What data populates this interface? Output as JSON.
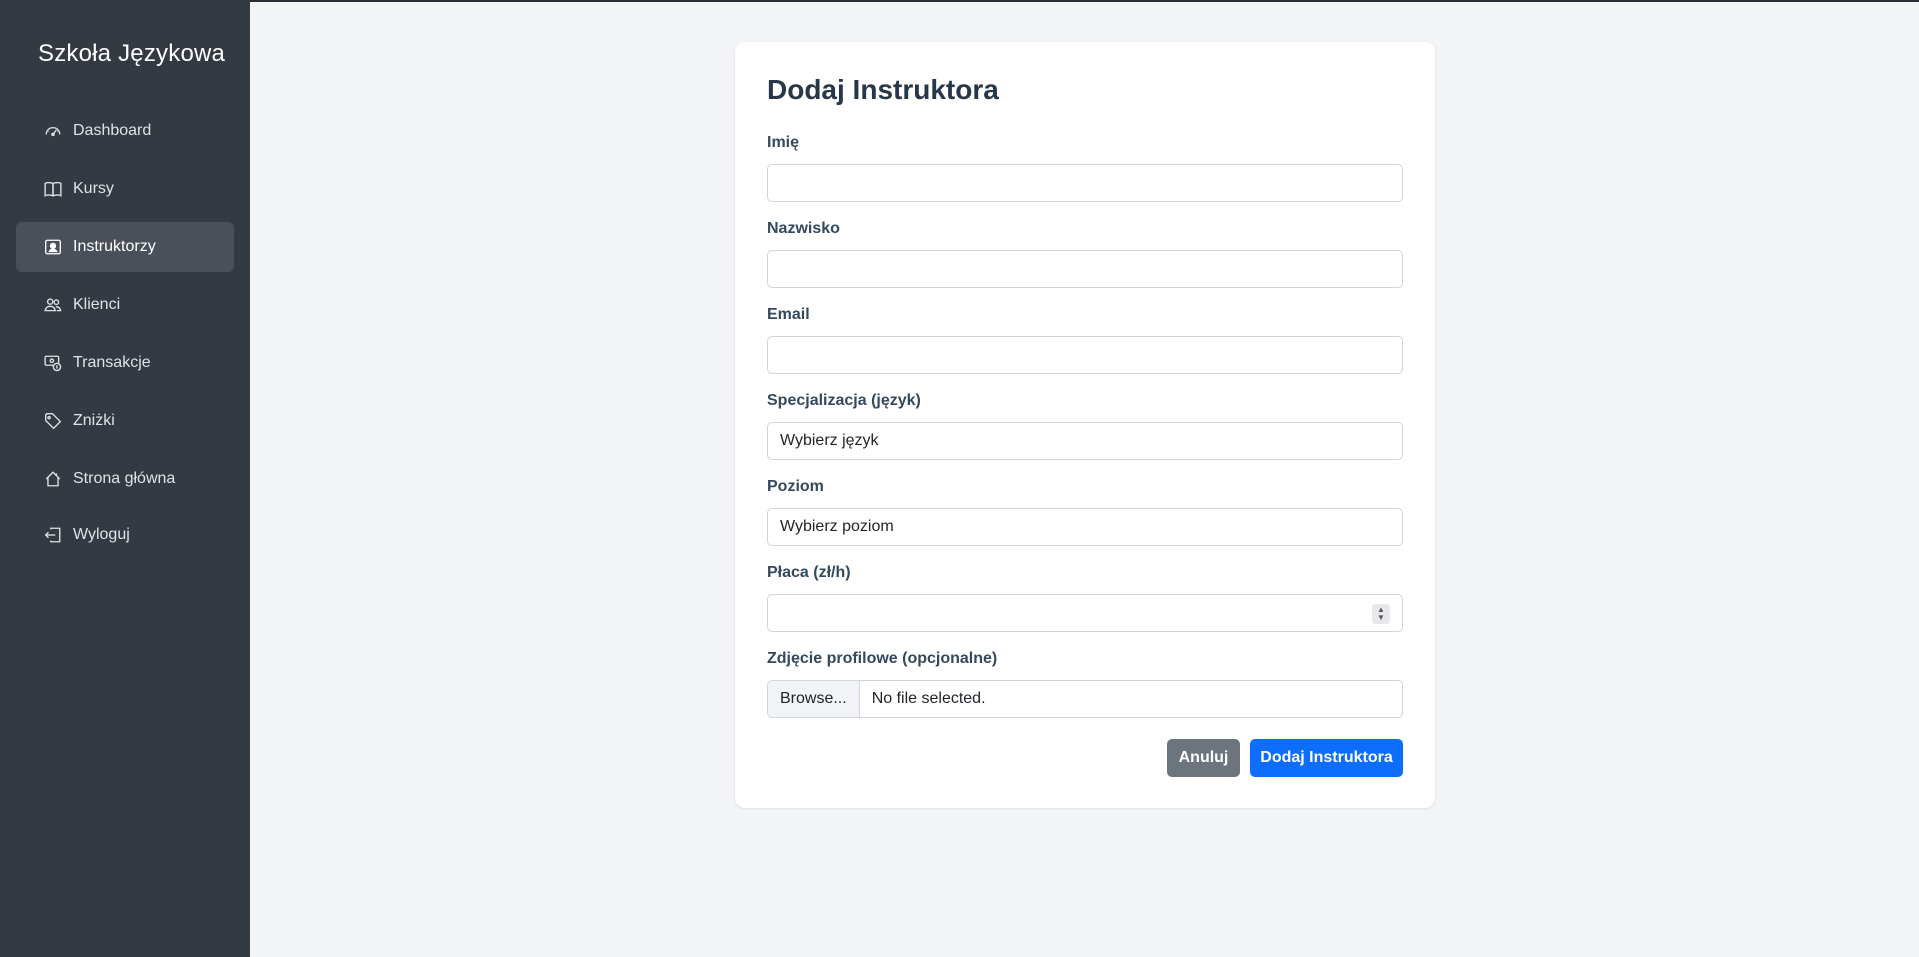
{
  "sidebar": {
    "brand": "Szkoła Językowa",
    "items": [
      {
        "label": "Dashboard",
        "icon": "speedometer-icon"
      },
      {
        "label": "Kursy",
        "icon": "book-icon"
      },
      {
        "label": "Instruktorzy",
        "icon": "person-badge-icon",
        "active": true
      },
      {
        "label": "Klienci",
        "icon": "people-icon"
      },
      {
        "label": "Transakcje",
        "icon": "cash-coin-icon"
      },
      {
        "label": "Zniżki",
        "icon": "tag-icon"
      },
      {
        "label": "Strona główna",
        "icon": "house-icon"
      },
      {
        "label": "Wyloguj",
        "icon": "box-arrow-left-icon"
      }
    ]
  },
  "form": {
    "title": "Dodaj Instruktora",
    "first_name": {
      "label": "Imię",
      "value": ""
    },
    "last_name": {
      "label": "Nazwisko",
      "value": ""
    },
    "email": {
      "label": "Email",
      "value": ""
    },
    "specialization": {
      "label": "Specjalizacja (język)",
      "selected": "Wybierz język"
    },
    "level": {
      "label": "Poziom",
      "selected": "Wybierz poziom"
    },
    "rate": {
      "label": "Płaca (zł/h)",
      "value": ""
    },
    "photo": {
      "label": "Zdjęcie profilowe (opcjonalne)",
      "browse_label": "Browse...",
      "file_status": "No file selected."
    },
    "cancel_label": "Anuluj",
    "submit_label": "Dodaj Instruktora"
  },
  "colors": {
    "sidebar_bg": "#343a42",
    "active_item_bg": "#4a5059",
    "primary": "#0d6efd",
    "secondary": "#6c757d",
    "page_bg": "#f3f4f6"
  }
}
